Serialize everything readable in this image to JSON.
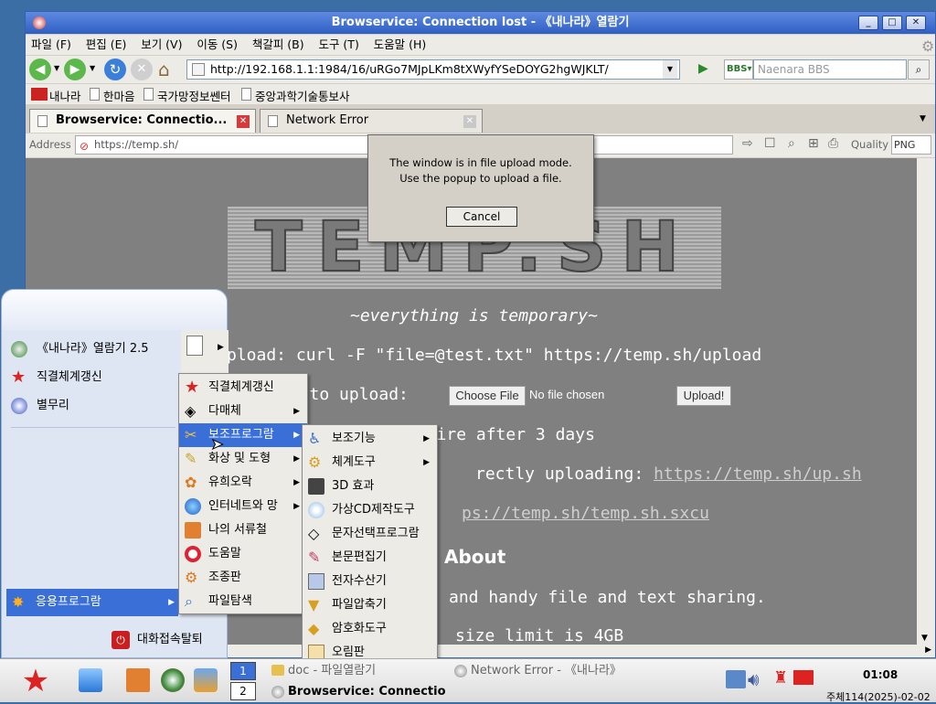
{
  "window": {
    "title": "Browservice: Connection lost - 《내나라》열람기"
  },
  "menu": [
    "파일 (F)",
    "편집 (E)",
    "보기 (V)",
    "이동 (S)",
    "책갈피 (B)",
    "도구 (T)",
    "도움말 (H)"
  ],
  "nav": {
    "url": "http://192.168.1.1:1984/16/uRGo7MJpLKm8tXWyfYSeDOYG2hgWJKLT/",
    "search_engine": "BBS",
    "search_placeholder": "Naenara BBS"
  },
  "bookmarks": [
    "내나라",
    "한마음",
    "국가망정보쎈터",
    "중앙과학기술통보사"
  ],
  "tabs": [
    {
      "label": "Browservice: Connectio..."
    },
    {
      "label": "Network Error"
    }
  ],
  "addr": {
    "label": "Address",
    "url": "https://temp.sh/",
    "quality_label": "Quality",
    "quality_value": "PNG"
  },
  "page": {
    "logo": "TEMP.SH",
    "tagline": "~everything is temporary~",
    "upload_cmd": "pload: curl -F \"file=@test.txt\" https://temp.sh/upload",
    "file_label": "le to upload:",
    "choose": "Choose File",
    "nofile": "No file chosen",
    "upload_btn": "Upload!",
    "expire": "Files expire after 3 days",
    "direct_pre": "rectly uploading: ",
    "direct_link": "https://temp.sh/up.sh",
    "sxcu": "ps://temp.sh/temp.sh.sxcu",
    "about": "About",
    "about_text": "and handy file and text sharing.",
    "limit_text": "size limit is 4GB"
  },
  "dialog": {
    "line1": "The window is in file upload mode.",
    "line2": "Use the popup to upload a file.",
    "cancel": "Cancel"
  },
  "start": {
    "items": [
      "《내나라》열람기 2.5",
      "직결체계갱신",
      "별무리"
    ],
    "apps": "응용프로그람",
    "logout": "대화접속탈퇴"
  },
  "sub1": [
    "직결체계갱신",
    "다매체",
    "보조프로그람",
    "화상 및 도형",
    "유희오락",
    "인터네트와 망",
    "나의 서류철",
    "도움말",
    "조종판",
    "파일탐색"
  ],
  "sub2": [
    "보조기능",
    "체계도구",
    "3D 효과",
    "가상CD제작도구",
    "문자선택프로그람",
    "본문편집기",
    "전자수산기",
    "파일압축기",
    "암호화도구",
    "오림판"
  ],
  "taskbar": {
    "tasks": [
      "doc - 파일열람기",
      "Network Error - 《내나라》",
      "Browservice: Connectio"
    ],
    "workspaces": [
      "1",
      "2"
    ],
    "time": "01:08",
    "date": "주체114(2025)-02-02"
  },
  "colors": {
    "title": "#2f5fc4",
    "selection": "#3a6fd8",
    "content": "#808080"
  }
}
